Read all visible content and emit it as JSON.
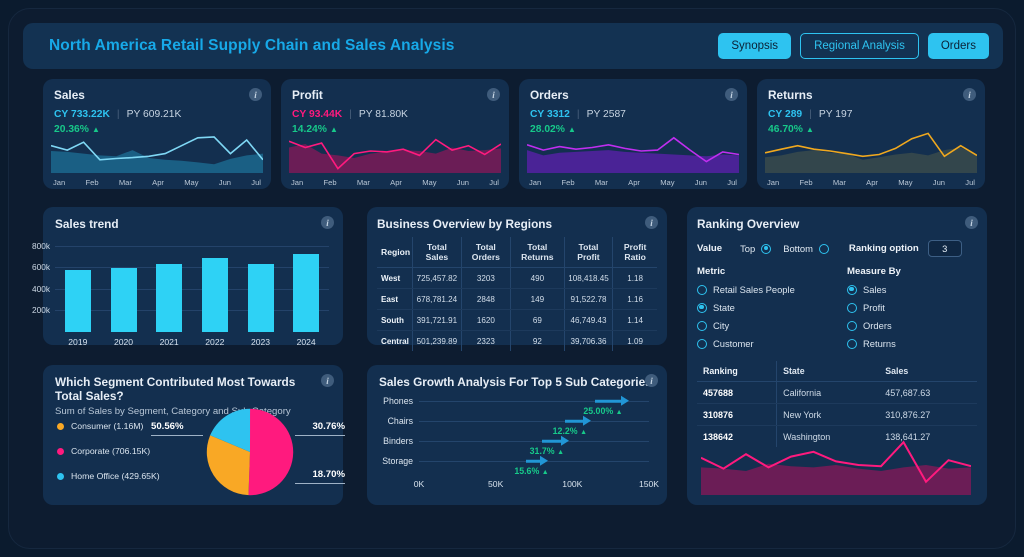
{
  "header": {
    "title": "North America Retail Supply Chain and Sales Analysis",
    "tabs": [
      {
        "label": "Synopsis",
        "style": "filled"
      },
      {
        "label": "Regional Analysis",
        "style": "outline"
      },
      {
        "label": "Orders",
        "style": "filled"
      }
    ]
  },
  "info_icon_glyph": "i",
  "kpis": [
    {
      "title": "Sales",
      "cy": "CY 733.22K",
      "py": "PY 609.21K",
      "pct": "20.36%",
      "arrow": "▲",
      "cy_color": "#2ec3f0",
      "line_color": "#7fd8f5",
      "area_color": "#1a5f84",
      "months": [
        "Jan",
        "Feb",
        "Mar",
        "Apr",
        "May",
        "Jun",
        "Jul"
      ],
      "line": [
        62,
        52,
        70,
        30,
        33,
        35,
        38,
        44,
        62,
        80,
        82,
        44,
        75,
        30
      ],
      "area": [
        50,
        48,
        44,
        40,
        38,
        52,
        34,
        30,
        28,
        24,
        20,
        32,
        40,
        44
      ]
    },
    {
      "title": "Profit",
      "cy": "CY 93.44K",
      "py": "PY 81.80K",
      "pct": "14.24%",
      "arrow": "▲",
      "cy_color": "#ff1a7e",
      "line_color": "#ff1a7e",
      "area_color": "#6b1d56",
      "months": [
        "Jan",
        "Feb",
        "Mar",
        "Apr",
        "May",
        "Jun",
        "Jul"
      ],
      "line": [
        72,
        58,
        68,
        10,
        44,
        50,
        48,
        54,
        40,
        76,
        52,
        62,
        42,
        66
      ],
      "area": [
        58,
        66,
        44,
        40,
        34,
        44,
        48,
        52,
        50,
        44,
        58,
        50,
        52,
        56
      ]
    },
    {
      "title": "Orders",
      "cy": "CY 3312",
      "py": "PY 2587",
      "pct": "28.02%",
      "arrow": "▲",
      "cy_color": "#2ec3f0",
      "line_color": "#c02ef0",
      "area_color": "#4a2396",
      "months": [
        "Jan",
        "Feb",
        "Mar",
        "Apr",
        "May",
        "Jun",
        "Jul"
      ],
      "line": [
        64,
        52,
        60,
        54,
        58,
        64,
        56,
        50,
        52,
        80,
        52,
        26,
        48,
        42
      ],
      "area": [
        52,
        40,
        46,
        48,
        50,
        52,
        48,
        46,
        44,
        42,
        40,
        38,
        42,
        40
      ]
    },
    {
      "title": "Returns",
      "cy": "CY 289",
      "py": "PY 197",
      "pct": "46.70%",
      "arrow": "▲",
      "cy_color": "#2ec3f0",
      "line_color": "#f0a81e",
      "area_color": "#33464c",
      "months": [
        "Jan",
        "Feb",
        "Mar",
        "Apr",
        "May",
        "Jun",
        "Jul"
      ],
      "line": [
        46,
        54,
        62,
        54,
        50,
        44,
        38,
        42,
        56,
        78,
        90,
        38,
        62,
        40
      ],
      "area": [
        36,
        40,
        48,
        52,
        46,
        44,
        30,
        36,
        42,
        46,
        40,
        52,
        58,
        40
      ]
    }
  ],
  "sales_trend": {
    "title": "Sales trend",
    "chart_data": {
      "type": "bar",
      "title": "Sales trend",
      "categories": [
        "2019",
        "2020",
        "2021",
        "2022",
        "2023",
        "2024"
      ],
      "values": [
        570000,
        595000,
        627000,
        690000,
        627000,
        720000
      ],
      "ticks": [
        "800k",
        "600k",
        "400k",
        "200k"
      ],
      "tick_values": [
        800000,
        600000,
        400000,
        200000
      ],
      "ylim": [
        0,
        880000
      ],
      "xlabel": "",
      "ylabel": "",
      "bar_color": "#2ed2f5",
      "grid": true
    }
  },
  "business_overview": {
    "title": "Business Overview by Regions",
    "columns": [
      "Region",
      "Total Sales",
      "Total Orders",
      "Total Returns",
      "Total Profit",
      "Profit Ratio"
    ],
    "rows": [
      [
        "West",
        "725,457.82",
        "3203",
        "490",
        "108,418.45",
        "1.18"
      ],
      [
        "East",
        "678,781.24",
        "2848",
        "149",
        "91,522.78",
        "1.16"
      ],
      [
        "South",
        "391,721.91",
        "1620",
        "69",
        "46,749.43",
        "1.14"
      ],
      [
        "Central",
        "501,239.89",
        "2323",
        "92",
        "39,706.36",
        "1.09"
      ]
    ]
  },
  "ranking": {
    "title": "Ranking Overview",
    "value_label": "Value",
    "top_label": "Top",
    "bottom_label": "Bottom",
    "top_selected": true,
    "bottom_selected": false,
    "ranking_option_label": "Ranking option",
    "ranking_option_value": "3",
    "metric_label": "Metric",
    "metric_options": [
      {
        "label": "Retail Sales People",
        "selected": false
      },
      {
        "label": "State",
        "selected": true
      },
      {
        "label": "City",
        "selected": false
      },
      {
        "label": "Customer",
        "selected": false
      }
    ],
    "measure_label": "Measure By",
    "measure_options": [
      {
        "label": "Sales",
        "selected": true
      },
      {
        "label": "Profit",
        "selected": false
      },
      {
        "label": "Orders",
        "selected": false
      },
      {
        "label": "Returns",
        "selected": false
      }
    ],
    "columns": [
      "Ranking",
      "State",
      "Sales"
    ],
    "rows": [
      [
        "457688",
        "California",
        "457,687.63"
      ],
      [
        "310876",
        "New York",
        "310,876.27"
      ],
      [
        "138642",
        "Washington",
        "138,641.27"
      ]
    ],
    "chart_data": {
      "type": "area",
      "line_color": "#ff1a7e",
      "area_color": "#6b1d56",
      "line": [
        62,
        44,
        68,
        46,
        64,
        72,
        56,
        50,
        48,
        88,
        22,
        58,
        48
      ],
      "area": [
        46,
        44,
        40,
        52,
        48,
        46,
        50,
        44,
        40,
        46,
        50,
        44,
        46
      ]
    }
  },
  "segment": {
    "title": "Which Segment Contributed Most Towards Total Sales?",
    "subtitle": "Sum of Sales by Segment, Category and Sub-Category",
    "chart_data": {
      "type": "pie",
      "title": "Which Segment Contributed Most Towards Total Sales?",
      "legend_position": "left",
      "labels": [
        "Consumer",
        "Corporate",
        "Home Office"
      ],
      "legend_entries": [
        "Consumer (1.16M)",
        "Corporate (706.15K)",
        "Home Office (429.65K)"
      ],
      "raw_values": [
        "1.16M",
        "706.15K",
        "429.65K"
      ],
      "slices": [
        {
          "label": "Corporate",
          "percent": 50.56,
          "percent_label": "50.56%",
          "color": "#ff1a7e"
        },
        {
          "label": "Consumer",
          "percent": 30.76,
          "percent_label": "30.76%",
          "color": "#f9a825"
        },
        {
          "label": "Home Office",
          "percent": 18.7,
          "percent_label": "18.70%",
          "color": "#2ec3f0"
        }
      ],
      "legend_colors": [
        "#f9a825",
        "#ff1a7e",
        "#2ec3f0"
      ]
    }
  },
  "growth": {
    "title": "Sales Growth Analysis For Top 5 Sub Categories",
    "chart_data": {
      "type": "bar",
      "orientation": "horizontal-range",
      "title": "Sales Growth Analysis For Top 5 Sub Categories",
      "categories": [
        "Phones",
        "Chairs",
        "Binders",
        "Storage"
      ],
      "ranges": [
        [
          115000,
          135000
        ],
        [
          95000,
          110000
        ],
        [
          80000,
          96000
        ],
        [
          70000,
          82000
        ]
      ],
      "growth_labels": [
        "25.00%",
        "12.2%",
        "31.7%",
        "15.6%"
      ],
      "growth_values": [
        25.0,
        12.2,
        31.7,
        15.6
      ],
      "arrow_glyph": "▲",
      "xticks": [
        "0K",
        "50K",
        "100K",
        "150K"
      ],
      "xtick_values": [
        0,
        50000,
        100000,
        150000
      ],
      "xlim": [
        0,
        150000
      ],
      "arrow_color": "#2196d6",
      "growth_color": "#17c98a"
    }
  }
}
